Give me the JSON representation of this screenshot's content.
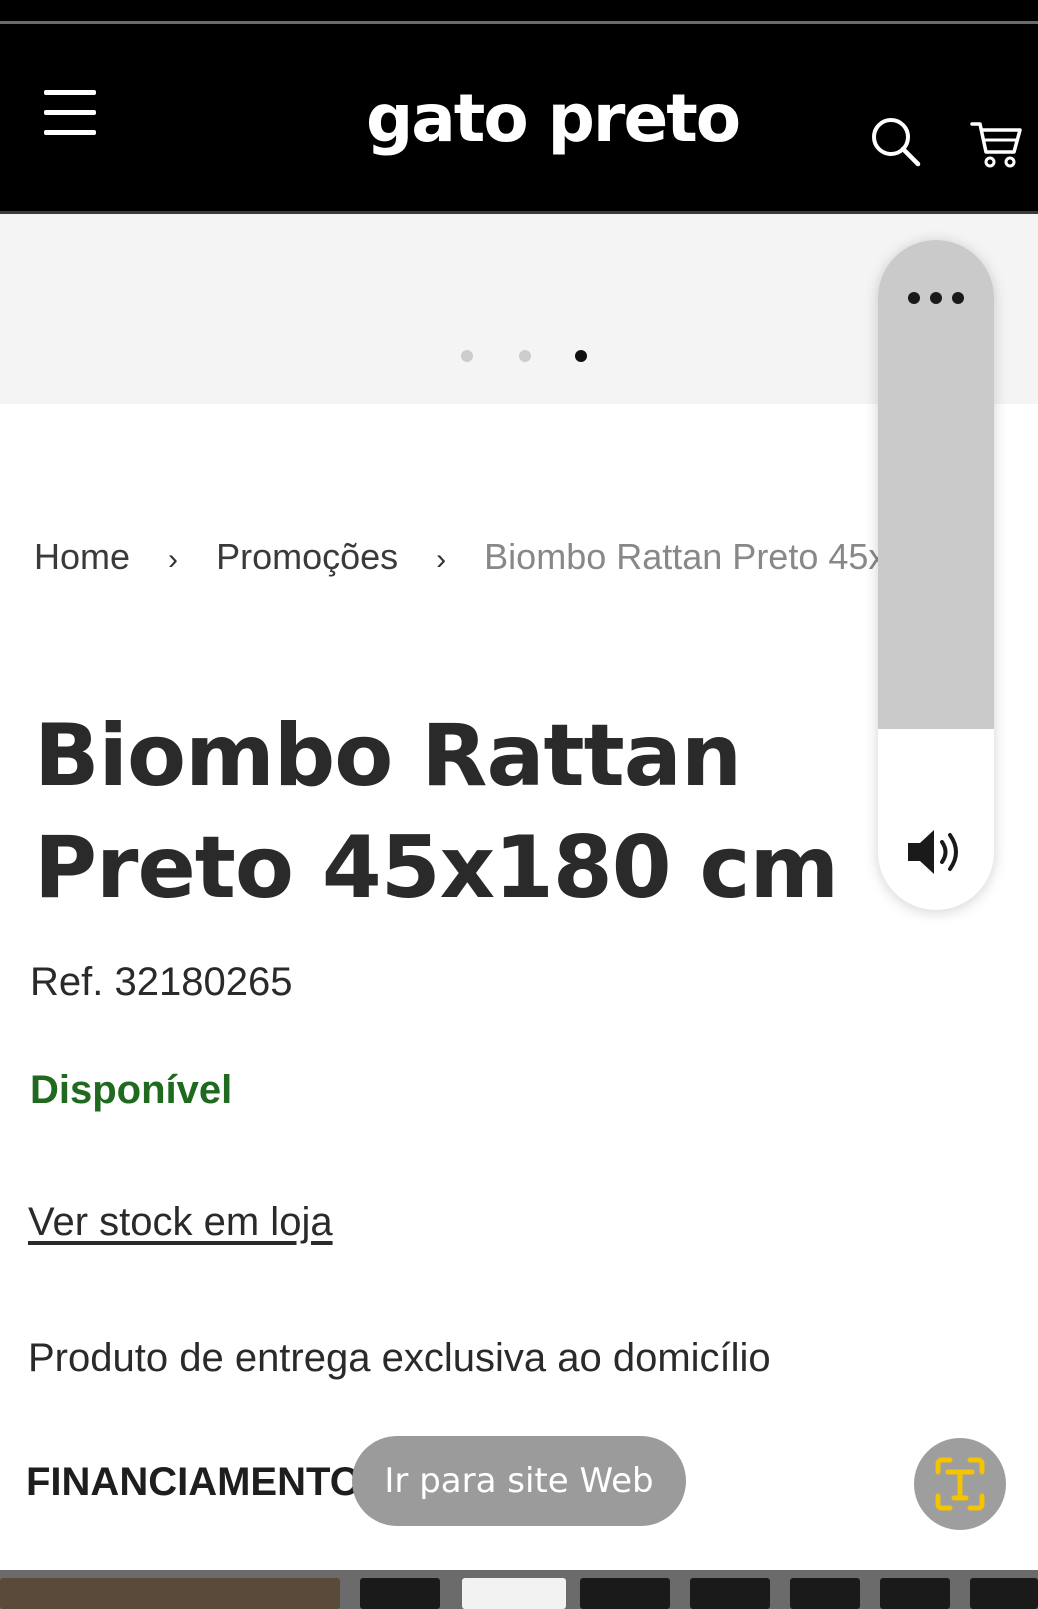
{
  "header": {
    "logo": "gato preto",
    "menu_icon": "hamburger-menu-icon",
    "search_icon": "search-icon",
    "cart_icon": "shopping-cart-icon"
  },
  "carousel": {
    "slide_count": 3,
    "active_index": 2
  },
  "breadcrumb": {
    "items": [
      "Home",
      "Promoções",
      "Biombo Rattan Preto 45x180 cm"
    ],
    "visible_current": "Biombo Rattan Preto 45x"
  },
  "product": {
    "title": "Biombo Rattan Preto 45x180 cm",
    "ref": "Ref. 32180265",
    "availability": "Disponível",
    "availability_color": "#1f6a1f",
    "stock_link": "Ver stock em loja",
    "delivery_note": "Produto de entrega exclusiva ao domicílio",
    "financing_label": "FINANCIAMENTO"
  },
  "volume_overlay": {
    "more_icon": "more-options-icon",
    "speaker_icon": "speaker-icon",
    "level": 0.27
  },
  "web_pill": {
    "label": "Ir para site Web"
  },
  "scan_button": {
    "icon": "text-scan-icon",
    "accent": "#f5c400"
  }
}
